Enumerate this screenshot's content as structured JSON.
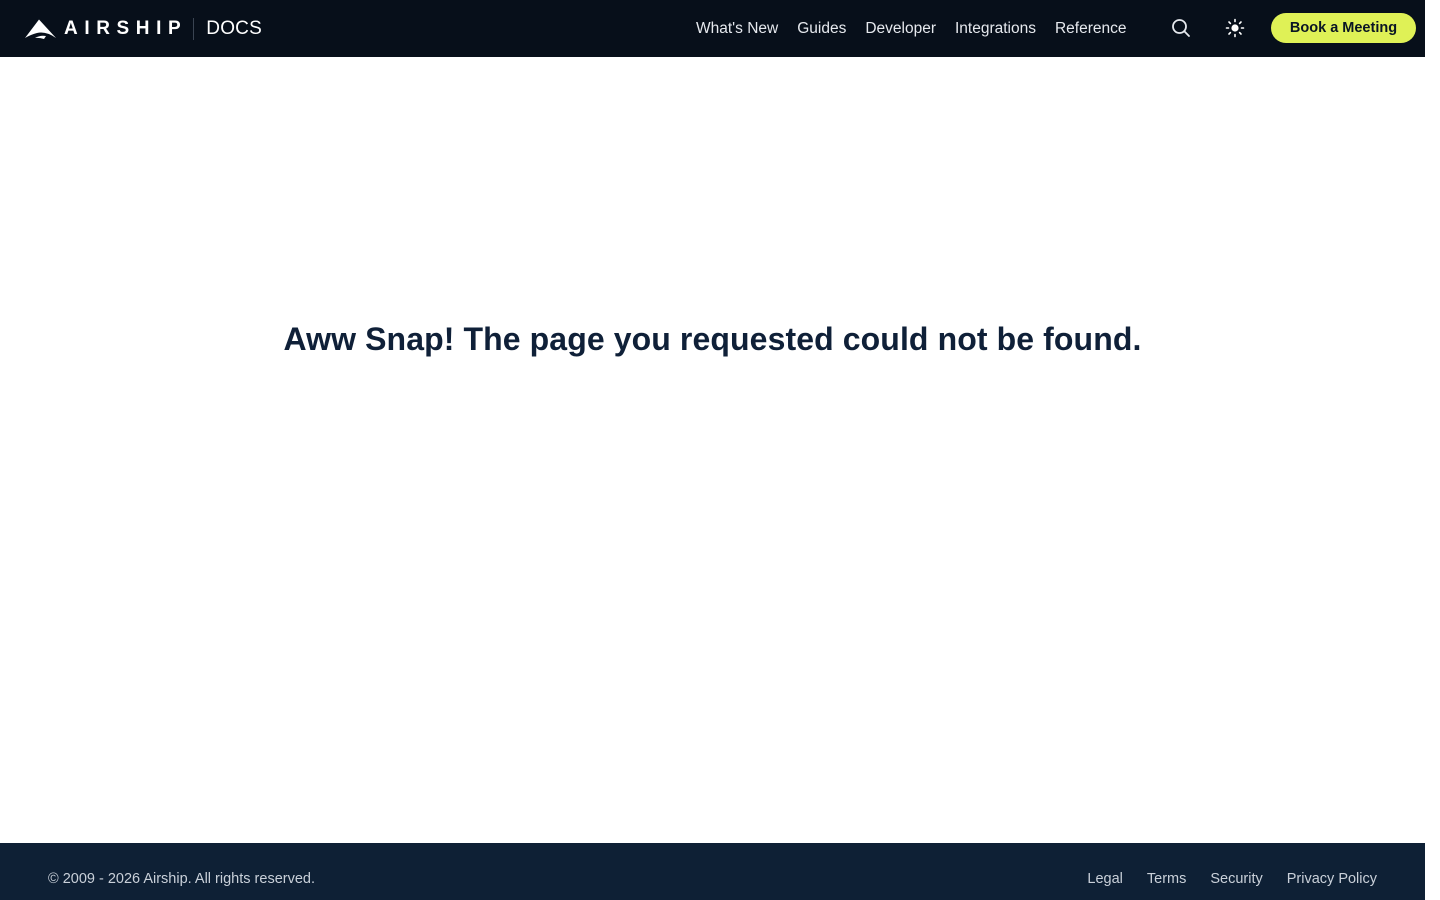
{
  "header": {
    "logo_text": "AIRSHIP",
    "section_label": "DOCS",
    "nav": [
      {
        "label": "What's New"
      },
      {
        "label": "Guides"
      },
      {
        "label": "Developer"
      },
      {
        "label": "Integrations"
      },
      {
        "label": "Reference"
      }
    ],
    "search_icon": "search-icon",
    "theme_icon": "sun-icon",
    "cta_label": "Book a Meeting"
  },
  "main": {
    "error_message": "Aww Snap! The page you requested could not be found."
  },
  "footer": {
    "copyright": "© 2009 - 2026 Airship. All rights reserved.",
    "links": [
      {
        "label": "Legal"
      },
      {
        "label": "Terms"
      },
      {
        "label": "Security"
      },
      {
        "label": "Privacy Policy"
      }
    ]
  },
  "colors": {
    "header_bg": "#070f1a",
    "footer_bg": "#0e2035",
    "cta_bg": "#dff156",
    "heading_text": "#0f2038"
  }
}
